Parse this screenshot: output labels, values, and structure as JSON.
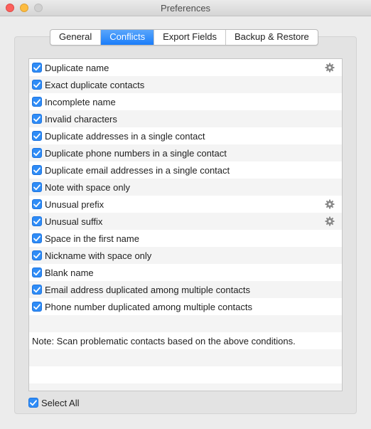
{
  "window": {
    "title": "Preferences"
  },
  "tabs": [
    {
      "label": "General",
      "active": false
    },
    {
      "label": "Conflicts",
      "active": true
    },
    {
      "label": "Export Fields",
      "active": false
    },
    {
      "label": "Backup & Restore",
      "active": false
    }
  ],
  "conditions": [
    {
      "label": "Duplicate name",
      "checked": true,
      "has_settings": true
    },
    {
      "label": "Exact duplicate contacts",
      "checked": true,
      "has_settings": false
    },
    {
      "label": "Incomplete name",
      "checked": true,
      "has_settings": false
    },
    {
      "label": "Invalid characters",
      "checked": true,
      "has_settings": false
    },
    {
      "label": "Duplicate addresses in a single contact",
      "checked": true,
      "has_settings": false
    },
    {
      "label": "Duplicate phone numbers in a single contact",
      "checked": true,
      "has_settings": false
    },
    {
      "label": "Duplicate email addresses in a single contact",
      "checked": true,
      "has_settings": false
    },
    {
      "label": "Note with space only",
      "checked": true,
      "has_settings": false
    },
    {
      "label": "Unusual prefix",
      "checked": true,
      "has_settings": true
    },
    {
      "label": "Unusual suffix",
      "checked": true,
      "has_settings": true
    },
    {
      "label": "Space in the first name",
      "checked": true,
      "has_settings": false
    },
    {
      "label": "Nickname with space only",
      "checked": true,
      "has_settings": false
    },
    {
      "label": "Blank name",
      "checked": true,
      "has_settings": false
    },
    {
      "label": "Email address duplicated among multiple contacts",
      "checked": true,
      "has_settings": false
    },
    {
      "label": "Phone number duplicated among multiple contacts",
      "checked": true,
      "has_settings": false
    }
  ],
  "note": "Note: Scan problematic contacts based on the above conditions.",
  "select_all": {
    "label": "Select All",
    "checked": true
  },
  "colors": {
    "accent": "#2f8cf6",
    "tab_active": "#1a7dfa"
  },
  "icons": {
    "settings": "gear-icon",
    "check": "checkmark-icon"
  }
}
